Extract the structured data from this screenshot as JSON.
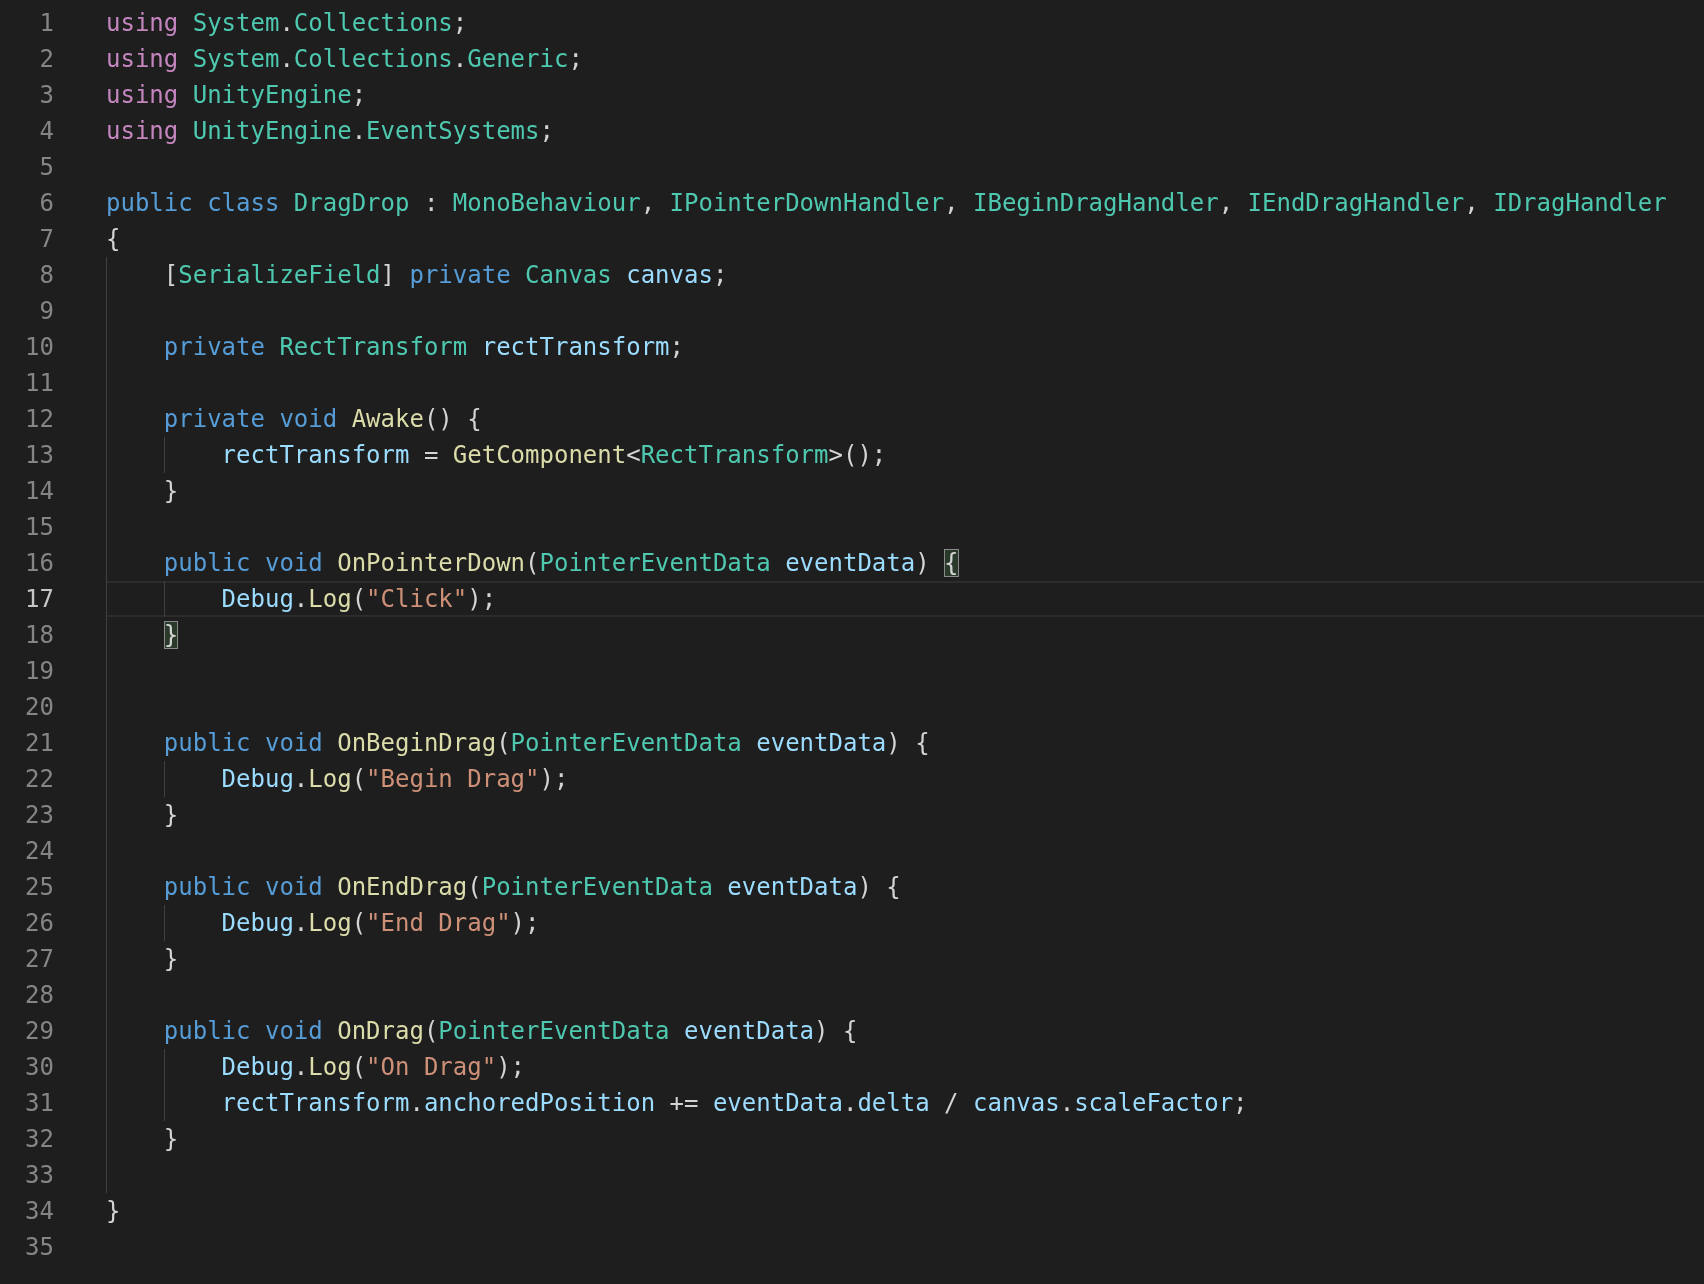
{
  "editor": {
    "lines": [
      {
        "number": "1",
        "current": false,
        "tokens": [
          {
            "kind": "control",
            "text": "using "
          },
          {
            "kind": "type",
            "text": "System"
          },
          {
            "kind": "plain",
            "text": "."
          },
          {
            "kind": "type",
            "text": "Collections"
          },
          {
            "kind": "plain",
            "text": ";"
          }
        ]
      },
      {
        "number": "2",
        "current": false,
        "tokens": [
          {
            "kind": "control",
            "text": "using "
          },
          {
            "kind": "type",
            "text": "System"
          },
          {
            "kind": "plain",
            "text": "."
          },
          {
            "kind": "type",
            "text": "Collections"
          },
          {
            "kind": "plain",
            "text": "."
          },
          {
            "kind": "type",
            "text": "Generic"
          },
          {
            "kind": "plain",
            "text": ";"
          }
        ]
      },
      {
        "number": "3",
        "current": false,
        "tokens": [
          {
            "kind": "control",
            "text": "using "
          },
          {
            "kind": "type",
            "text": "UnityEngine"
          },
          {
            "kind": "plain",
            "text": ";"
          }
        ]
      },
      {
        "number": "4",
        "current": false,
        "tokens": [
          {
            "kind": "control",
            "text": "using "
          },
          {
            "kind": "type",
            "text": "UnityEngine"
          },
          {
            "kind": "plain",
            "text": "."
          },
          {
            "kind": "type",
            "text": "EventSystems"
          },
          {
            "kind": "plain",
            "text": ";"
          }
        ]
      },
      {
        "number": "5",
        "current": false
      },
      {
        "number": "6",
        "current": false,
        "tokens": [
          {
            "kind": "keyword",
            "text": "public class "
          },
          {
            "kind": "type",
            "text": "DragDrop"
          },
          {
            "kind": "plain",
            "text": " : "
          },
          {
            "kind": "type",
            "text": "MonoBehaviour"
          },
          {
            "kind": "plain",
            "text": ", "
          },
          {
            "kind": "type",
            "text": "IPointerDownHandler"
          },
          {
            "kind": "plain",
            "text": ", "
          },
          {
            "kind": "type",
            "text": "IBeginDragHandler"
          },
          {
            "kind": "plain",
            "text": ", "
          },
          {
            "kind": "type",
            "text": "IEndDragHandler"
          },
          {
            "kind": "plain",
            "text": ", "
          },
          {
            "kind": "type",
            "text": "IDragHandler"
          }
        ]
      },
      {
        "number": "7",
        "current": false,
        "tokens": [
          {
            "kind": "plain",
            "text": "{"
          }
        ]
      },
      {
        "number": "8",
        "current": false,
        "tokens": [
          {
            "kind": "plain",
            "text": "    ["
          },
          {
            "kind": "type",
            "text": "SerializeField"
          },
          {
            "kind": "plain",
            "text": "] "
          },
          {
            "kind": "keyword",
            "text": "private "
          },
          {
            "kind": "type",
            "text": "Canvas "
          },
          {
            "kind": "variable",
            "text": "canvas"
          },
          {
            "kind": "plain",
            "text": ";"
          }
        ]
      },
      {
        "number": "9",
        "current": false
      },
      {
        "number": "10",
        "current": false,
        "tokens": [
          {
            "kind": "keyword",
            "text": "    private "
          },
          {
            "kind": "type",
            "text": "RectTransform "
          },
          {
            "kind": "variable",
            "text": "rectTransform"
          },
          {
            "kind": "plain",
            "text": ";"
          }
        ]
      },
      {
        "number": "11",
        "current": false
      },
      {
        "number": "12",
        "current": false,
        "tokens": [
          {
            "kind": "keyword",
            "text": "    private void "
          },
          {
            "kind": "function",
            "text": "Awake"
          },
          {
            "kind": "plain",
            "text": "() {"
          }
        ]
      },
      {
        "number": "13",
        "current": false,
        "tokens": [
          {
            "kind": "variable",
            "text": "        rectTransform"
          },
          {
            "kind": "plain",
            "text": " = "
          },
          {
            "kind": "function",
            "text": "GetComponent"
          },
          {
            "kind": "plain",
            "text": "<"
          },
          {
            "kind": "type",
            "text": "RectTransform"
          },
          {
            "kind": "plain",
            "text": ">();"
          }
        ]
      },
      {
        "number": "14",
        "current": false,
        "tokens": [
          {
            "kind": "plain",
            "text": "    }"
          }
        ]
      },
      {
        "number": "15",
        "current": false
      },
      {
        "number": "16",
        "current": false,
        "tokens": [
          {
            "kind": "keyword",
            "text": "    public void "
          },
          {
            "kind": "function",
            "text": "OnPointerDown"
          },
          {
            "kind": "plain",
            "text": "("
          },
          {
            "kind": "type",
            "text": "PointerEventData "
          },
          {
            "kind": "variable",
            "text": "eventData"
          },
          {
            "kind": "plain",
            "text": ") "
          },
          {
            "kind": "bracket_match",
            "text": "{"
          }
        ]
      },
      {
        "number": "17",
        "current": true,
        "tokens": [
          {
            "kind": "variable",
            "text": "        Debug"
          },
          {
            "kind": "plain",
            "text": "."
          },
          {
            "kind": "function",
            "text": "Log"
          },
          {
            "kind": "plain",
            "text": "("
          },
          {
            "kind": "string",
            "text": "\"Click\""
          },
          {
            "kind": "plain",
            "text": ");"
          }
        ]
      },
      {
        "number": "18",
        "current": false,
        "tokens": [
          {
            "kind": "bracket_match",
            "text": "    }"
          }
        ]
      },
      {
        "number": "19",
        "current": false
      },
      {
        "number": "20",
        "current": false
      },
      {
        "number": "21",
        "current": false,
        "tokens": [
          {
            "kind": "keyword",
            "text": "    public void "
          },
          {
            "kind": "function",
            "text": "OnBeginDrag"
          },
          {
            "kind": "plain",
            "text": "("
          },
          {
            "kind": "type",
            "text": "PointerEventData "
          },
          {
            "kind": "variable",
            "text": "eventData"
          },
          {
            "kind": "plain",
            "text": ") {"
          }
        ]
      },
      {
        "number": "22",
        "current": false,
        "tokens": [
          {
            "kind": "variable",
            "text": "        Debug"
          },
          {
            "kind": "plain",
            "text": "."
          },
          {
            "kind": "function",
            "text": "Log"
          },
          {
            "kind": "plain",
            "text": "("
          },
          {
            "kind": "string",
            "text": "\"Begin Drag\""
          },
          {
            "kind": "plain",
            "text": ");"
          }
        ]
      },
      {
        "number": "23",
        "current": false,
        "tokens": [
          {
            "kind": "plain",
            "text": "    }"
          }
        ]
      },
      {
        "number": "24",
        "current": false
      },
      {
        "number": "25",
        "current": false,
        "tokens": [
          {
            "kind": "keyword",
            "text": "    public void "
          },
          {
            "kind": "function",
            "text": "OnEndDrag"
          },
          {
            "kind": "plain",
            "text": "("
          },
          {
            "kind": "type",
            "text": "PointerEventData "
          },
          {
            "kind": "variable",
            "text": "eventData"
          },
          {
            "kind": "plain",
            "text": ") {"
          }
        ]
      },
      {
        "number": "26",
        "current": false,
        "tokens": [
          {
            "kind": "variable",
            "text": "        Debug"
          },
          {
            "kind": "plain",
            "text": "."
          },
          {
            "kind": "function",
            "text": "Log"
          },
          {
            "kind": "plain",
            "text": "("
          },
          {
            "kind": "string",
            "text": "\"End Drag\""
          },
          {
            "kind": "plain",
            "text": ");"
          }
        ]
      },
      {
        "number": "27",
        "current": false,
        "tokens": [
          {
            "kind": "plain",
            "text": "    }"
          }
        ]
      },
      {
        "number": "28",
        "current": false
      },
      {
        "number": "29",
        "current": false,
        "tokens": [
          {
            "kind": "keyword",
            "text": "    public void "
          },
          {
            "kind": "function",
            "text": "OnDrag"
          },
          {
            "kind": "plain",
            "text": "("
          },
          {
            "kind": "type",
            "text": "PointerEventData "
          },
          {
            "kind": "variable",
            "text": "eventData"
          },
          {
            "kind": "plain",
            "text": ") {"
          }
        ]
      },
      {
        "number": "30",
        "current": false,
        "tokens": [
          {
            "kind": "variable",
            "text": "        Debug"
          },
          {
            "kind": "plain",
            "text": "."
          },
          {
            "kind": "function",
            "text": "Log"
          },
          {
            "kind": "plain",
            "text": "("
          },
          {
            "kind": "string",
            "text": "\"On Drag\""
          },
          {
            "kind": "plain",
            "text": ");"
          }
        ]
      },
      {
        "number": "31",
        "current": false,
        "tokens": [
          {
            "kind": "variable",
            "text": "        rectTransform"
          },
          {
            "kind": "plain",
            "text": "."
          },
          {
            "kind": "variable",
            "text": "anchoredPosition"
          },
          {
            "kind": "plain",
            "text": " += "
          },
          {
            "kind": "variable",
            "text": "eventData"
          },
          {
            "kind": "plain",
            "text": "."
          },
          {
            "kind": "variable",
            "text": "delta"
          },
          {
            "kind": "plain",
            "text": " / "
          },
          {
            "kind": "variable",
            "text": "canvas"
          },
          {
            "kind": "plain",
            "text": "."
          },
          {
            "kind": "variable",
            "text": "scaleFactor"
          },
          {
            "kind": "plain",
            "text": ";"
          }
        ]
      },
      {
        "number": "32",
        "current": false,
        "tokens": [
          {
            "kind": "plain",
            "text": "    }"
          }
        ]
      },
      {
        "number": "33",
        "current": false
      },
      {
        "number": "34",
        "current": false,
        "tokens": [
          {
            "kind": "plain",
            "text": "}"
          }
        ]
      },
      {
        "number": "35",
        "current": false
      }
    ]
  }
}
